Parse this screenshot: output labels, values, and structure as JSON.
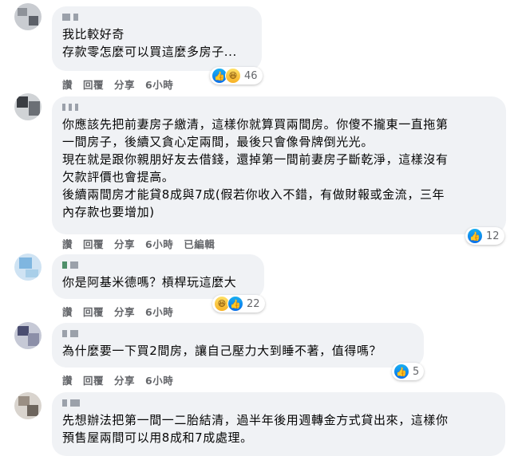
{
  "actions": {
    "like": "讚",
    "reply": "回覆",
    "share": "分享",
    "edited": "已編輯"
  },
  "icons": {
    "like": "thumbs-up-icon",
    "haha": "laughing-face-icon"
  },
  "colors": {
    "bubble": "#f0f2f5",
    "meta": "#65676b",
    "like": "#0a6fe8",
    "haha": "#f7b125"
  },
  "comments": [
    {
      "lines": "我比較好奇\n存款零怎麼可以買這麼多房子...",
      "time": "6小時",
      "reactions": "46"
    },
    {
      "lines": "你應該先把前妻房子繳清，這樣你就算買兩間房。你傻不攏東一直拖第\n一間房子，後續又貪心定兩間，最後只會像骨牌倒光光。\n現在就是跟你親朋好友去借錢，還掉第一間前妻房子斷乾淨，這樣沒有\n欠款評價也會提高。\n後續兩間房才能貸8成與7成(假若你收入不錯，有做財報或金流，三年\n內存款也要增加)",
      "time": "6小時",
      "reactions": "12"
    },
    {
      "lines": "你是阿基米德嗎？槓桿玩這麼大",
      "time": "6小時",
      "reactions": "22"
    },
    {
      "lines": "為什麼要一下買2間房，讓自己壓力大到睡不著，值得嗎？",
      "time": "6小時",
      "reactions": "5"
    },
    {
      "lines": "先想辦法把第一間一二胎結清，過半年後用週轉金方式貸出來，這樣你\n預售屋兩間可以用8成和7成處理。",
      "time": "",
      "reactions": ""
    }
  ]
}
